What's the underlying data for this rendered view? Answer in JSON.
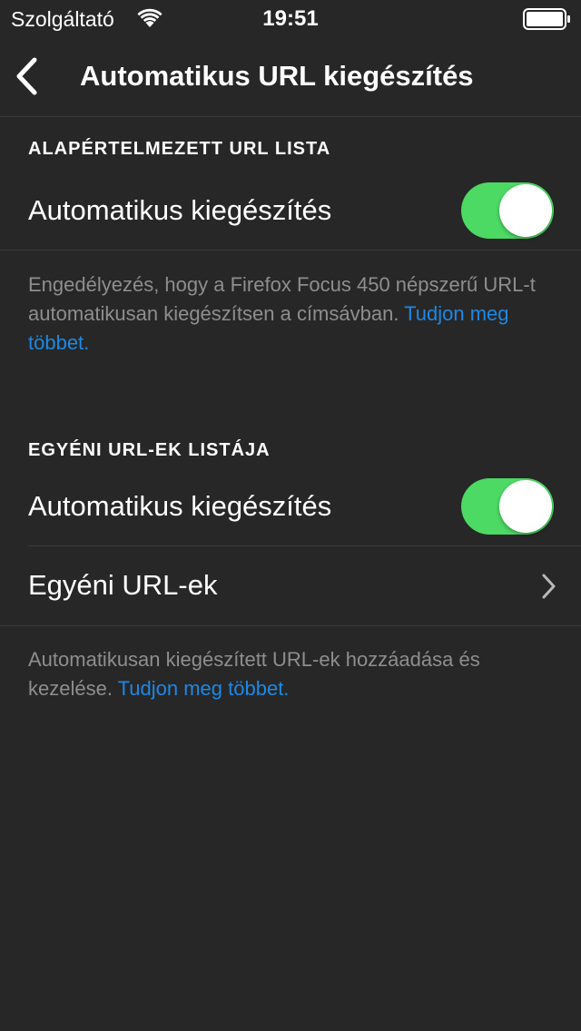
{
  "status_bar": {
    "carrier": "Szolgáltató",
    "time": "19:51",
    "wifi_icon": "wifi-icon",
    "battery_icon": "battery-full-icon"
  },
  "nav": {
    "title": "Automatikus URL kiegészítés",
    "back_icon": "chevron-left-icon"
  },
  "default_list": {
    "header": "ALAPÉRTELMEZETT URL LISTA",
    "autocomplete_label": "Automatikus kiegészítés",
    "autocomplete_enabled": true,
    "footer_text": "Engedélyezés, hogy a Firefox Focus 450 népszerű URL-t automatikusan kiegészítsen a címsávban.",
    "footer_link": "Tudjon meg többet."
  },
  "custom_list": {
    "header": "EGYÉNI URL-EK LISTÁJA",
    "autocomplete_label": "Automatikus kiegészítés",
    "autocomplete_enabled": true,
    "custom_urls_label": "Egyéni URL-ek",
    "footer_text": "Automatikusan kiegészített URL-ek hozzáadása és kezelése.",
    "footer_link": "Tudjon meg többet."
  },
  "colors": {
    "background": "#272727",
    "toggle_on": "#4cd964",
    "link": "#1e88e5",
    "secondary_text": "#8e8e8e"
  }
}
